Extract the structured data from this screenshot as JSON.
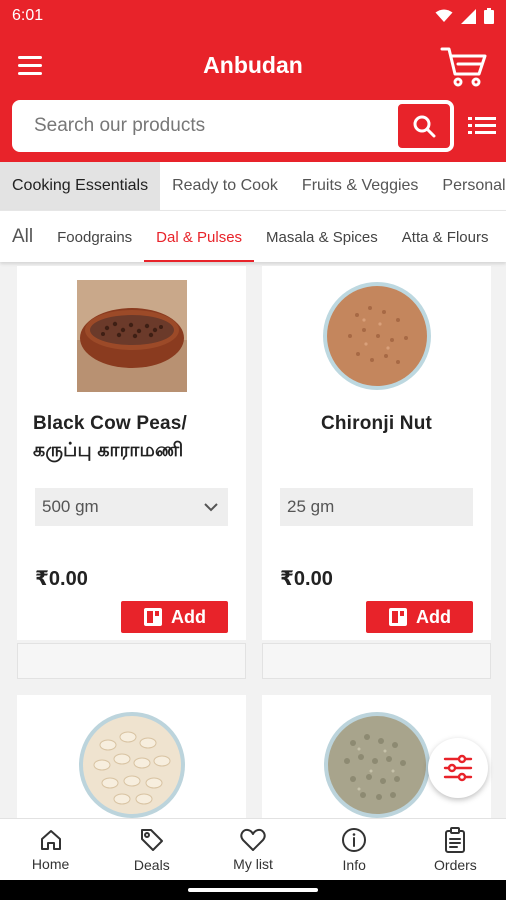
{
  "status_bar": {
    "time": "6:01"
  },
  "header": {
    "title": "Anbudan"
  },
  "search": {
    "placeholder": "Search our products"
  },
  "category_tabs": [
    {
      "label": "Cooking Essentials",
      "active": true
    },
    {
      "label": "Ready to Cook"
    },
    {
      "label": "Fruits & Veggies"
    },
    {
      "label": "Personal Care"
    }
  ],
  "sub_tabs": [
    {
      "label": "All"
    },
    {
      "label": "Foodgrains"
    },
    {
      "label": "Dal & Pulses",
      "active": true
    },
    {
      "label": "Masala & Spices"
    },
    {
      "label": "Atta & Flours"
    }
  ],
  "products": [
    {
      "name": "Black Cow Peas/ கருப்பு காராமணி",
      "quantity": "500 gm",
      "price": "₹0.00",
      "add_label": "Add"
    },
    {
      "name": "Chironji Nut",
      "quantity": "25 gm",
      "price": "₹0.00",
      "add_label": "Add"
    }
  ],
  "bottom_nav": [
    {
      "label": "Home"
    },
    {
      "label": "Deals"
    },
    {
      "label": "My list"
    },
    {
      "label": "Info"
    },
    {
      "label": "Orders"
    }
  ],
  "colors": {
    "brand": "#e8232a",
    "background": "#f2f2f2"
  }
}
